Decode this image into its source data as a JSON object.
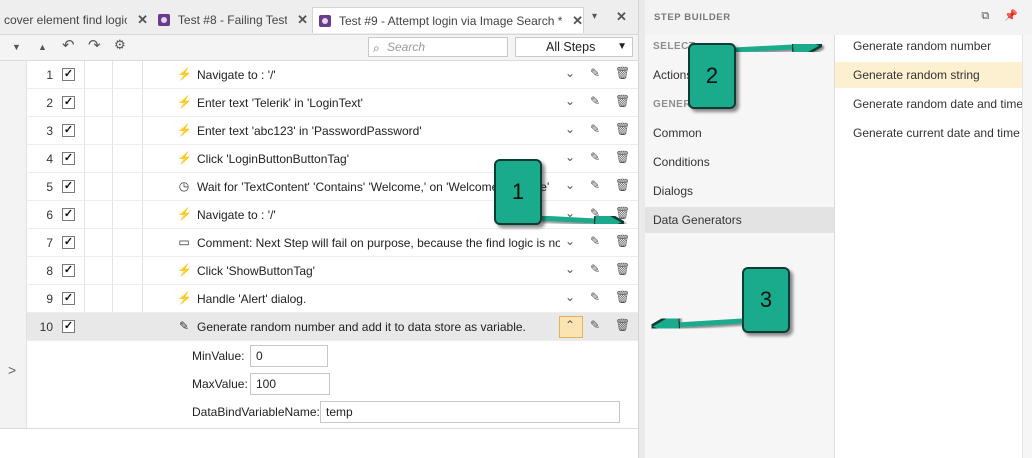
{
  "tabs": [
    {
      "label": "cover element find logic",
      "close": "✕"
    },
    {
      "label": "Test #8 - Failing Test",
      "close": "✕"
    },
    {
      "label": "Test #9 - Attempt login via Image Search *",
      "close": "✕"
    }
  ],
  "tab_menu_glyph": "▾",
  "tab_close_all_glyph": "✕",
  "toolbar": {
    "search_placeholder": "Search",
    "filter_value": "All Steps"
  },
  "steps": [
    {
      "num": "1",
      "checked": true,
      "icon": "lightning-icon",
      "text": "Navigate to : '/'"
    },
    {
      "num": "2",
      "checked": true,
      "icon": "lightning-icon",
      "text": "Enter text 'Telerik' in 'LoginText'"
    },
    {
      "num": "3",
      "checked": true,
      "icon": "lightning-icon",
      "text": "Enter text 'abc123' in 'PasswordPassword'"
    },
    {
      "num": "4",
      "checked": true,
      "icon": "lightning-icon",
      "text": "Click 'LoginButtonButtonTag'"
    },
    {
      "num": "5",
      "checked": true,
      "icon": "clock-icon",
      "text": "Wait for 'TextContent' 'Contains' 'Welcome,' on 'WelcomeMessage'"
    },
    {
      "num": "6",
      "checked": true,
      "icon": "lightning-icon",
      "text": "Navigate to : '/'"
    },
    {
      "num": "7",
      "checked": true,
      "icon": "comment-icon",
      "text": "Comment: Next Step will fail on purpose, because the find logic is not correct"
    },
    {
      "num": "8",
      "checked": true,
      "icon": "lightning-icon",
      "text": "Click 'ShowButtonTag'"
    },
    {
      "num": "9",
      "checked": true,
      "icon": "lightning-icon",
      "text": "Handle 'Alert' dialog."
    },
    {
      "num": "10",
      "checked": true,
      "icon": "eyedropper-icon",
      "text": "Generate random number and add it to data store as variable."
    }
  ],
  "properties": {
    "min_label": "MinValue:",
    "min_value": "0",
    "max_label": "MaxValue:",
    "max_value": "100",
    "var_label": "DataBindVariableName:",
    "var_value": "temp"
  },
  "expander_glyph": ">",
  "step_builder": {
    "title": "STEP BUILDER",
    "section_select": "SELECT",
    "section_generic": "GENER",
    "categories": [
      "Actions",
      "Common",
      "Conditions",
      "Dialogs",
      "Data Generators"
    ],
    "selected_category": "Data Generators",
    "items": [
      "Generate random number",
      "Generate random string",
      "Generate random date and time",
      "Generate current date and time"
    ],
    "highlighted_item": "Generate random string"
  },
  "callouts": [
    "1",
    "2",
    "3"
  ],
  "colors": {
    "callout_fill": "#1aaa8c",
    "callout_border": "#0b3d34",
    "selection_bg": "#fbe3b2",
    "highlight_item": "#fdf0d1",
    "tab_icon": "#6a3b8c"
  }
}
